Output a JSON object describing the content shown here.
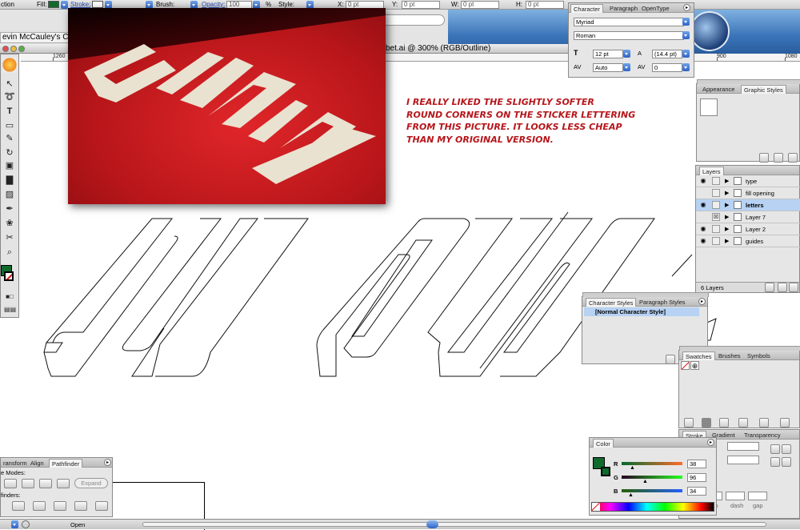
{
  "control_bar": {
    "mode_label": "ction",
    "fill_label": "Fill:",
    "stroke_label": "Stroke:",
    "brush_label": "Brush:",
    "opacity_label": "Opacity:",
    "opacity_value": "100",
    "opacity_unit": "%",
    "style_label": "Style:",
    "x_label": "X:",
    "x_value": "0 pt",
    "y_label": "Y:",
    "y_value": "0 pt",
    "w_label": "W:",
    "w_value": "0 pt",
    "h_label": "H:",
    "h_value": "0 pt",
    "fill_color": "#0f6a2c"
  },
  "browser": {
    "tab_title": "evin McCauley's Cor"
  },
  "document": {
    "title": "bet.ai @ 300% (RGB/Outline)"
  },
  "ruler": {
    "labels": [
      "1260",
      "900",
      "1080"
    ]
  },
  "annotation": {
    "lines": [
      "I really liked the slightly softer",
      "round corners on the sticker lettering",
      "From this picture.  It looks less cheap",
      "than my original version."
    ],
    "color": "#b5161b"
  },
  "character_panel": {
    "tabs": [
      "Character",
      "Paragraph",
      "OpenType"
    ],
    "font_family": "Myriad",
    "font_style": "Roman",
    "font_size": "12 pt",
    "leading": "(14.4 pt)",
    "kerning": "Auto",
    "tracking": "0"
  },
  "appearance_panel": {
    "tabs": [
      "Appearance",
      "Graphic Styles"
    ]
  },
  "layers_panel": {
    "tabs": [
      "Layers"
    ],
    "layers": [
      {
        "name": "type",
        "visible": true,
        "locked": false,
        "selected": false
      },
      {
        "name": "fill opening",
        "visible": false,
        "locked": false,
        "selected": false
      },
      {
        "name": "letters",
        "visible": true,
        "locked": false,
        "selected": true
      },
      {
        "name": "Layer 7",
        "visible": false,
        "locked": true,
        "selected": false
      },
      {
        "name": "Layer 2",
        "visible": true,
        "locked": false,
        "selected": false
      },
      {
        "name": "guides",
        "visible": true,
        "locked": false,
        "selected": false
      }
    ],
    "count_label": "6 Layers"
  },
  "character_styles_panel": {
    "tabs": [
      "Character Styles",
      "Paragraph Styles"
    ],
    "items": [
      "[Normal Character Style]"
    ]
  },
  "swatches_panel": {
    "tabs": [
      "Swatches",
      "Brushes",
      "Symbols"
    ]
  },
  "stroke_panel": {
    "tabs": [
      "Stroke",
      "Gradient",
      "Transparency"
    ],
    "ne_label": "ne",
    "dash_labels": [
      "dash",
      "gap",
      "dash",
      "gap"
    ]
  },
  "color_panel": {
    "tabs": [
      "Color"
    ],
    "r_label": "R",
    "r_value": "38",
    "g_label": "G",
    "g_value": "96",
    "b_label": "B",
    "b_value": "34",
    "current_color": "#26602a"
  },
  "pathfinder_panel": {
    "tabs": [
      "ransform",
      "Align",
      "Pathfinder"
    ],
    "shape_modes_label": "e Modes:",
    "pathfinders_label": "finders:",
    "expand_label": "Expand"
  },
  "bottom_bar": {
    "status_text": "Open"
  },
  "icons": {
    "tools": [
      "selection-tool-icon",
      "lasso-tool-icon",
      "type-tool-icon",
      "rectangle-tool-icon",
      "pencil-tool-icon",
      "rotate-tool-icon",
      "free-transform-tool-icon",
      "graph-tool-icon",
      "gradient-tool-icon",
      "eyedropper-tool-icon",
      "symbol-sprayer-icon",
      "scissors-tool-icon",
      "zoom-tool-icon"
    ]
  }
}
